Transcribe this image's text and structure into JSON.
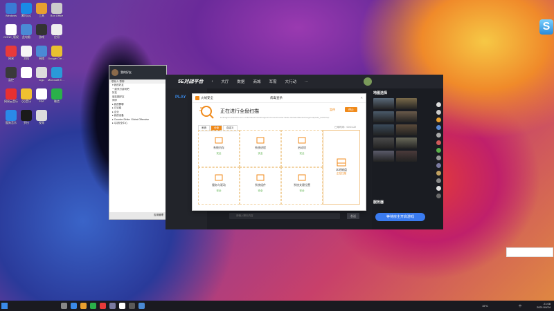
{
  "desktop": {
    "icons": [
      {
        "name": "windows-icon",
        "label": "Windows",
        "color": "#3a7bd5"
      },
      {
        "name": "tencent-qq-icon",
        "label": "腾讯QQ",
        "color": "#1a8ae6"
      },
      {
        "name": "tool-icon",
        "label": "工具",
        "color": "#e8a030"
      },
      {
        "name": "box-icon",
        "label": "Box Office",
        "color": "#ccc"
      },
      {
        "name": "gone-icon",
        "label": "GONE_版权",
        "color": "#fff"
      },
      {
        "name": "pc-icon",
        "label": "此电脑",
        "color": "#4a8ad5"
      },
      {
        "name": "game-icon",
        "label": "游戏",
        "color": "#333"
      },
      {
        "name": "app-icon",
        "label": "应用",
        "color": "#eee"
      },
      {
        "name": "wyy-icon",
        "label": "网易",
        "color": "#e83a3a"
      },
      {
        "name": "doc-icon",
        "label": "文档",
        "color": "#f5f5f5"
      },
      {
        "name": "net-icon",
        "label": "网络",
        "color": "#4a8ad5"
      },
      {
        "name": "chrome-icon",
        "label": "Google Chrome",
        "color": "#e8c030"
      },
      {
        "name": "monitor-icon",
        "label": "监控",
        "color": "#3a3a3a"
      },
      {
        "name": "blank-icon",
        "label": "",
        "color": "#fff"
      },
      {
        "name": "file-icon",
        "label": "logo",
        "color": "#ddd"
      },
      {
        "name": "edge-icon",
        "label": "Microsoft Edge",
        "color": "#2a9ad8"
      },
      {
        "name": "netease-icon",
        "label": "网易云音乐",
        "color": "#e83030"
      },
      {
        "name": "qqmusic-icon",
        "label": "QQ音乐",
        "color": "#f0c030"
      },
      {
        "name": "pdf-icon",
        "label": "PDF",
        "color": "#fff"
      },
      {
        "name": "wechat-icon",
        "label": "微信",
        "color": "#2ab04a"
      },
      {
        "name": "kugou-icon",
        "label": "酷狗音乐",
        "color": "#2a8ae8"
      },
      {
        "name": "logi-icon",
        "label": "罗技",
        "color": "#1a1a1a"
      },
      {
        "name": "film-icon",
        "label": "视频",
        "color": "#ddd"
      }
    ],
    "s_badge": "S"
  },
  "chat_window": {
    "title": "我的好友",
    "toolbar": "联系人  群聊",
    "groups": [
      "▾ 我的好友",
      "  一起来打游戏吧",
      "  好友",
      "  朋友圈好友",
      "  同学",
      "▸ 我的群聊",
      "▸ 讨论组",
      "▸ 企业",
      "▸ 我的设备",
      "▸ Counter-Strike: Global Offensive",
      "▸ QQ安全中心"
    ],
    "footer_label": "应用管理"
  },
  "platform": {
    "brand": "5E对战平台",
    "nav": [
      "大厅",
      "数据",
      "商城",
      "军需",
      "大行动"
    ],
    "more": "···",
    "left_label": "PLAY",
    "right_sections": {
      "map_select": "地图选择",
      "server": "服务器"
    },
    "start_button": "等待房主开启游戏",
    "chat_placeholder": "请输入聊天内容",
    "send": "发送"
  },
  "scanner": {
    "window_title": "火绒安全",
    "sub_title": "病毒查杀",
    "scan_title": "正在进行全盘扫描",
    "scan_path": "D:\\Program Files\\Common Files\\Steam\\steamapps\\common\\Counter-Strike Global Offensive\\csgo\\maps\\de_dust2.bsp",
    "pause": "暂停",
    "stop": "停止",
    "tabs": [
      "系统",
      "全盘",
      "自定义"
    ],
    "elapsed": "已用时间：00:01:22",
    "cells": [
      {
        "icon": "system-memory-icon",
        "label": "系统内存",
        "status": "安全"
      },
      {
        "icon": "system-process-icon",
        "label": "系统进程",
        "status": "安全"
      },
      {
        "icon": "startup-icon",
        "label": "启动项",
        "status": "安全"
      },
      {
        "icon": "service-driver-icon",
        "label": "服务与驱动",
        "status": "安全"
      },
      {
        "icon": "system-component-icon",
        "label": "系统组件",
        "status": "安全"
      },
      {
        "icon": "system-location-icon",
        "label": "系统关键位置",
        "status": "安全"
      }
    ],
    "big_cell": {
      "icon": "disk-icon",
      "label": "本地磁盘",
      "status": "正在扫描"
    }
  },
  "taskbar": {
    "time": "21:08",
    "date": "2021/10/24",
    "temp": "15°C",
    "lang": "中"
  }
}
